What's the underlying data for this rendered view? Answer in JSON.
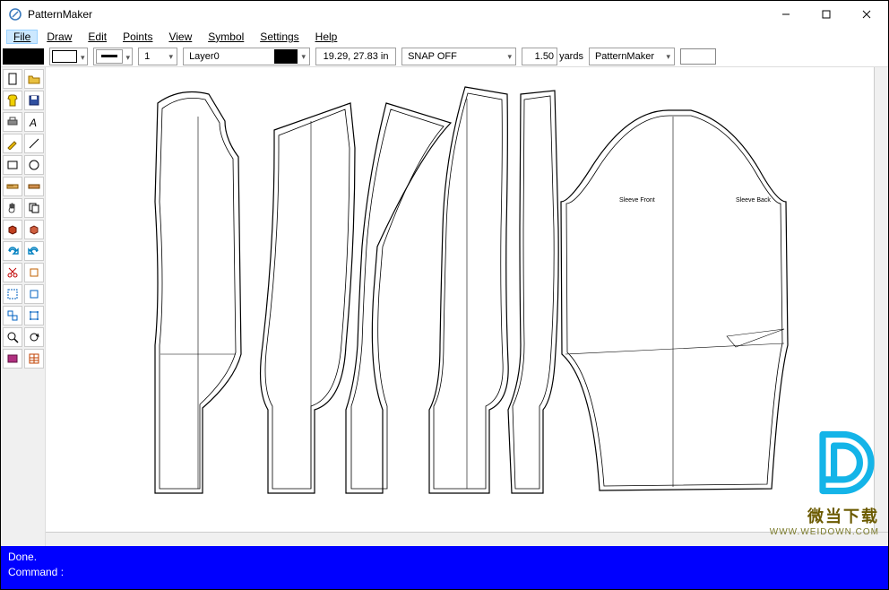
{
  "window": {
    "title": "PatternMaker"
  },
  "menu": {
    "items": [
      "File",
      "Draw",
      "Edit",
      "Points",
      "View",
      "Symbol",
      "Settings",
      "Help"
    ],
    "active_index": 0
  },
  "propbar": {
    "fill_swatch": "#000000",
    "stroke_swatch": "#ffffff",
    "line_weight_label": "1",
    "layer_name": "Layer0",
    "layer_color": "#000000",
    "coord_readout": "19.29, 27.83 in",
    "snap_mode": "SNAP OFF",
    "yards_value": "1.50",
    "yards_label": "yards",
    "library_combo": "PatternMaker"
  },
  "toolbar": {
    "icons": [
      "new-file-icon",
      "open-folder-icon",
      "shirt-icon",
      "save-icon",
      "print-icon",
      "text-icon",
      "pencil-icon",
      "line-icon",
      "rectangle-icon",
      "circle-icon",
      "ruler-icon",
      "ruler2-icon",
      "hand-icon",
      "copy-icon",
      "box3d-icon",
      "box3d2-icon",
      "redo-icon",
      "undo-icon",
      "scissors-icon",
      "clip-icon",
      "select-rect-icon",
      "crop-icon",
      "group-icon",
      "transform-icon",
      "zoom-icon",
      "refresh-icon",
      "book-icon",
      "table-icon"
    ]
  },
  "canvas": {
    "annotations": {
      "sleeve_front": "Sleeve Front",
      "sleeve_back": "Sleeve Back"
    }
  },
  "status": {
    "line1": "Done.",
    "line2": "Command :"
  },
  "watermark": {
    "text1": "微当下载",
    "text2": "WWW.WEIDOWN.COM"
  }
}
